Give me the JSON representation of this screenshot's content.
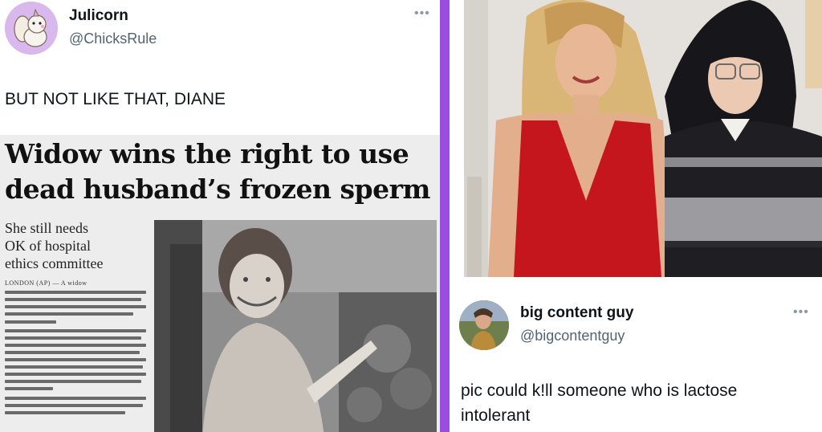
{
  "left_tweet": {
    "display_name": "Julicorn",
    "handle": "@ChicksRule",
    "text": "BUT NOT LIKE THAT, DIANE",
    "avatar_icon": "squirrel-avatar-icon",
    "more_icon": "more-options-icon",
    "clipping": {
      "headline_line1": "Widow wins the right to use",
      "headline_line2": "dead husband’s frozen sperm",
      "subhead_line1": "She still needs",
      "subhead_line2": "OK of hospital",
      "subhead_line3": "ethics committee",
      "dateline": "LONDON (AP) — A widow"
    }
  },
  "right_tweet": {
    "display_name": "big content guy",
    "handle": "@bigcontentguy",
    "text_line1": "pic could k!ll someone who is lactose",
    "text_line2": "intolerant",
    "avatar_icon": "user-avatar-icon",
    "more_icon": "more-options-icon"
  },
  "colors": {
    "divider": "#9b4de0",
    "avatar_bg": "#d9b8ee",
    "red_dress": "#c4161c"
  }
}
